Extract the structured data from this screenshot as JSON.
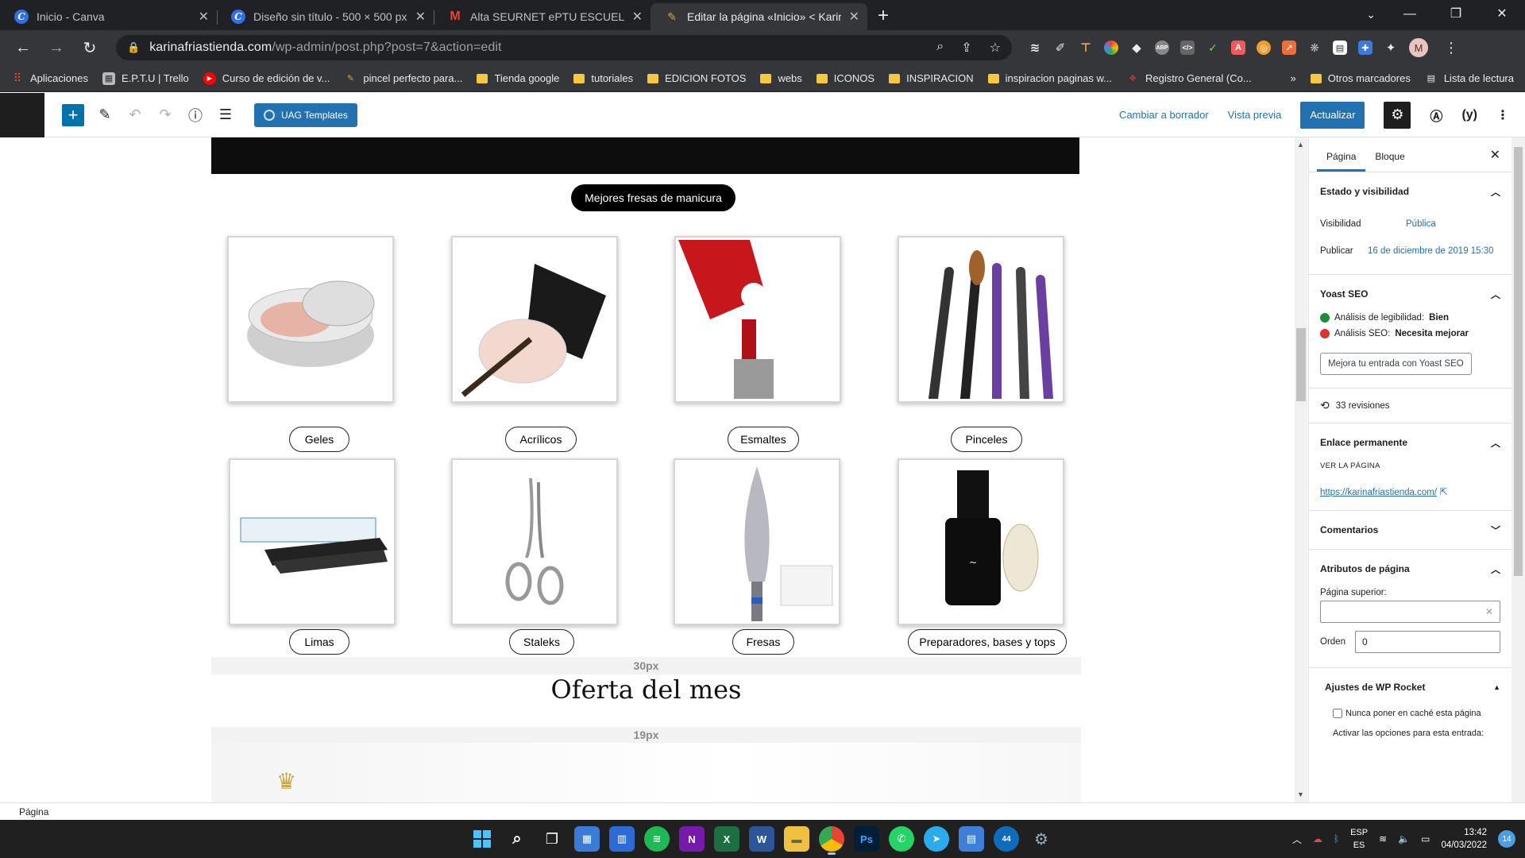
{
  "browser": {
    "tabs": [
      {
        "title": "Inicio - Canva",
        "icon": "canva-icon",
        "active": false
      },
      {
        "title": "Diseño sin título - 500 × 500 px",
        "icon": "canva-icon",
        "active": false
      },
      {
        "title": "Alta SEURNET ePTU ESCUELA DE FO",
        "icon": "gmail-icon",
        "active": false
      },
      {
        "title": "Editar la página «Inicio» < KarinaFri",
        "icon": "wordpress-icon",
        "active": true
      }
    ],
    "url_host": "karinafriastienda.com",
    "url_path": "/wp-admin/post.php?post=7&action=edit",
    "profile_initial": "M",
    "bookmarks": [
      {
        "label": "Aplicaciones",
        "type": "apps"
      },
      {
        "label": "E.P.T.U | Trello",
        "type": "site"
      },
      {
        "label": "Curso de edición de v...",
        "type": "youtube"
      },
      {
        "label": "pincel perfecto para...",
        "type": "site"
      },
      {
        "label": "Tienda google",
        "type": "folder"
      },
      {
        "label": "tutoriales",
        "type": "folder"
      },
      {
        "label": "EDICION FOTOS",
        "type": "folder"
      },
      {
        "label": "webs",
        "type": "folder"
      },
      {
        "label": "ICONOS",
        "type": "folder"
      },
      {
        "label": "INSPIRACION",
        "type": "folder"
      },
      {
        "label": "inspiracion paginas w...",
        "type": "folder"
      },
      {
        "label": "Registro General (Co...",
        "type": "site"
      }
    ],
    "bookmarks_overflow": "»",
    "other_bookmarks": "Otros marcadores",
    "reading_list": "Lista de lectura"
  },
  "editor": {
    "uag_label": "UAG Templates",
    "save_draft": "Cambiar a borrador",
    "preview": "Vista previa",
    "update": "Actualizar"
  },
  "canvas": {
    "featured_title": "Mejores fresas de manicura",
    "products": [
      {
        "label": "Geles"
      },
      {
        "label": "Acrílicos"
      },
      {
        "label": "Esmaltes"
      },
      {
        "label": "Pinceles"
      },
      {
        "label": "Limas"
      },
      {
        "label": "Staleks"
      },
      {
        "label": "Fresas"
      },
      {
        "label": "Preparadores, bases y tops"
      }
    ],
    "spacer_1": "30px",
    "section_title": "Oferta del mes",
    "spacer_2": "19px"
  },
  "sidebar": {
    "tab_page": "Página",
    "tab_block": "Bloque",
    "status_title": "Estado y visibilidad",
    "visibility_label": "Visibilidad",
    "visibility_value": "Pública",
    "publish_label": "Publicar",
    "publish_value": "16 de diciembre de 2019 15:30",
    "yoast_title": "Yoast SEO",
    "readability_label": "Análisis de legibilidad:",
    "readability_value": "Bien",
    "seo_label": "Análisis SEO:",
    "seo_value": "Necesita mejorar",
    "yoast_button": "Mejora tu entrada con Yoast SEO",
    "revisions": "33 revisiones",
    "permalink_title": "Enlace permanente",
    "view_page": "VER LA PÁGINA",
    "permalink_url": "https://karinafriastienda.com/",
    "comments_title": "Comentarios",
    "attributes_title": "Atributos de página",
    "parent_label": "Página superior:",
    "order_label": "Orden",
    "order_value": "0",
    "rocket_title": "Ajustes de WP Rocket",
    "no_cache_label": "Nunca poner en caché esta página",
    "activate_label": "Activar las opciones para esta entrada:"
  },
  "status_bar": "Página",
  "taskbar": {
    "lang": "ESP",
    "lang2": "ES",
    "time": "13:42",
    "date": "04/03/2022",
    "notifications": "14",
    "badge_count": "44"
  },
  "colors": {
    "wp_blue": "#2271b1",
    "chrome_dark": "#202124",
    "chrome_mid": "#35363a",
    "good": "#1e8c3a",
    "bad": "#dc3232"
  }
}
